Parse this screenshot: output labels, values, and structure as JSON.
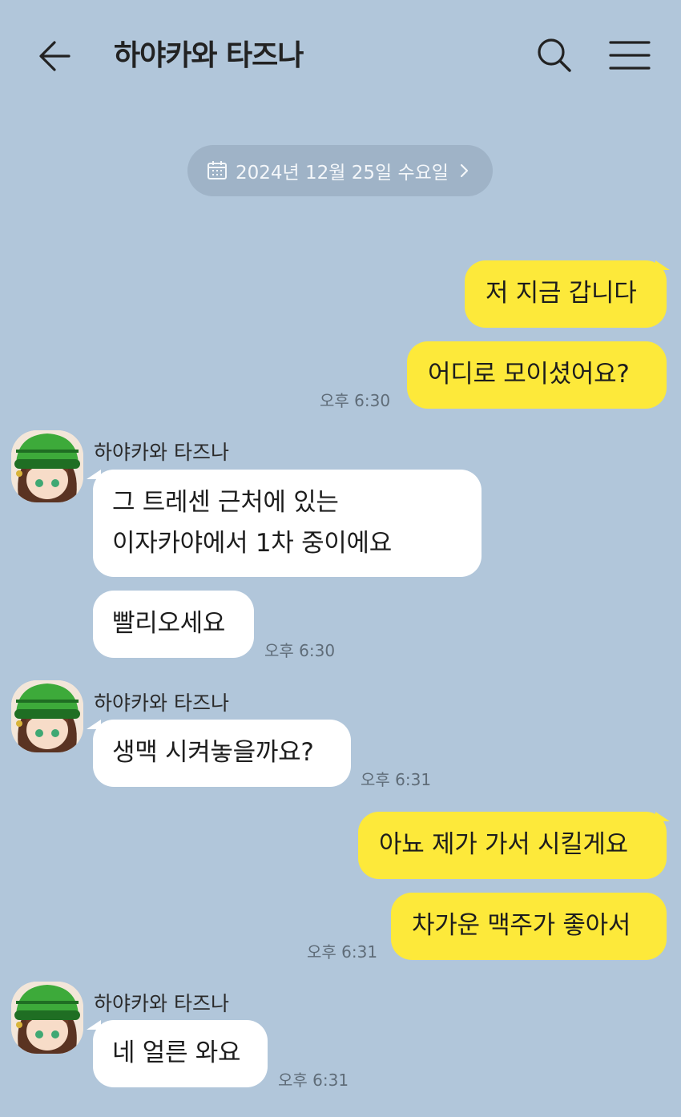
{
  "header": {
    "title": "하야카와 타즈나",
    "back_icon": "arrow-left-icon",
    "search_icon": "search-icon",
    "menu_icon": "hamburger-menu-icon"
  },
  "date_pill": {
    "icon": "calendar-icon",
    "text": "2024년 12월 25일 수요일",
    "chevron_icon": "chevron-right-icon"
  },
  "colors": {
    "background": "#b1c6da",
    "my_bubble": "#fde93a",
    "their_bubble": "#ffffff",
    "date_pill": "#9fb3c7"
  },
  "messages": [
    {
      "from": "me",
      "text": "저 지금 갑니다"
    },
    {
      "from": "me",
      "text": "어디로 모이셨어요?",
      "time": "오후 6:30"
    },
    {
      "from": "them",
      "sender": "하야카와 타즈나",
      "lines": [
        "그 트레센 근처에 있는",
        "이자카야에서 1차 중이에요"
      ]
    },
    {
      "from": "them",
      "text": "빨리오세요",
      "time": "오후 6:30"
    },
    {
      "from": "them",
      "sender": "하야카와 타즈나",
      "text": "생맥 시켜놓을까요?",
      "time": "오후 6:31"
    },
    {
      "from": "me",
      "text": "아뇨 제가 가서 시킬게요"
    },
    {
      "from": "me",
      "text": "차가운 맥주가 좋아서",
      "time": "오후 6:31"
    },
    {
      "from": "them",
      "sender": "하야카와 타즈나",
      "text": "네 얼른 와요",
      "time": "오후 6:31"
    }
  ]
}
